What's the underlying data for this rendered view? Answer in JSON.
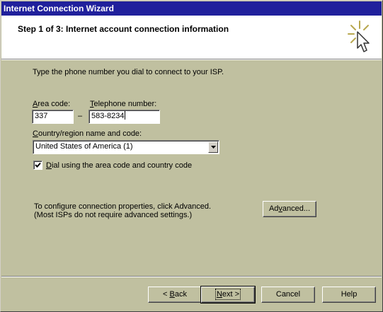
{
  "window": {
    "title": "Internet Connection Wizard"
  },
  "header": {
    "title": "Step 1 of 3: Internet account connection information",
    "icon": "wizard-cursor-sparkle-icon"
  },
  "content": {
    "instruction": "Type the phone number you dial to connect to your ISP.",
    "area_code": {
      "label_access": "A",
      "label_rest": "rea code:",
      "value": "337"
    },
    "dash": "–",
    "telephone": {
      "label_access": "T",
      "label_rest": "elephone number:",
      "value": "583-8234"
    },
    "country": {
      "label_access": "C",
      "label_rest": "ountry/region name and code:",
      "selected": "United States of America (1)"
    },
    "dial_checkbox": {
      "checked": true,
      "label_access": "D",
      "label_rest": "ial using the area code and country code"
    },
    "advanced_note_line1": "To configure connection properties, click Advanced.",
    "advanced_note_line2": "(Most ISPs do not require advanced settings.)",
    "advanced_button": {
      "pre": "Ad",
      "access": "v",
      "post": "anced..."
    }
  },
  "footer": {
    "back": {
      "pre": "< ",
      "access": "B",
      "post": "ack"
    },
    "next": {
      "access": "N",
      "post": "ext >"
    },
    "cancel": "Cancel",
    "help": "Help"
  },
  "colors": {
    "title_bar": "#20209c",
    "dialog_face": "#c0c0a0",
    "header_bg": "#ffffff"
  }
}
